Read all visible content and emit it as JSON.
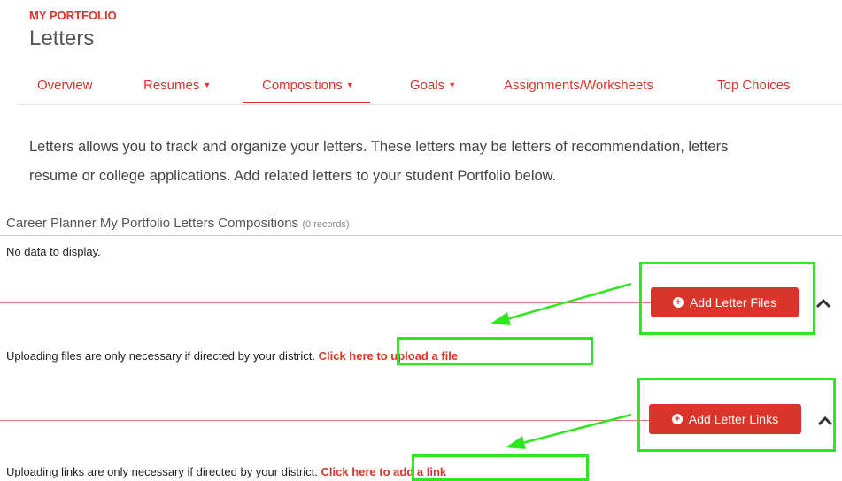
{
  "header": {
    "eyebrow": "MY PORTFOLIO",
    "title": "Letters"
  },
  "tabs": [
    {
      "label": "Overview",
      "dropdown": false
    },
    {
      "label": "Resumes",
      "dropdown": true
    },
    {
      "label": "Compositions",
      "dropdown": true,
      "active": true
    },
    {
      "label": "Goals",
      "dropdown": true
    },
    {
      "label": "Assignments/Worksheets",
      "dropdown": false
    },
    {
      "label": "Top Choices",
      "dropdown": false
    }
  ],
  "intro": {
    "line1": "Letters allows you to track and organize your letters. These letters may be letters of recommendation, letters",
    "line2": "resume or college applications. Add related letters to your student Portfolio below."
  },
  "grid": {
    "title": "Career Planner My Portfolio Letters Compositions",
    "count": "(0 records)",
    "empty": "No data to display."
  },
  "files": {
    "button": "Add Letter Files",
    "note": "Uploading files are only necessary if directed by your district.",
    "link": "Click here to upload a file"
  },
  "links": {
    "button": "Add Letter Links",
    "note": "Uploading links are only necessary if directed by your district.",
    "link": "Click here to add a link"
  },
  "colors": {
    "accent": "#d9352a",
    "highlight": "#2ee81f"
  },
  "icons": {
    "button": "plus-circle-icon",
    "collapse": "chevron-up-icon",
    "dropdown": "caret-down-icon"
  }
}
